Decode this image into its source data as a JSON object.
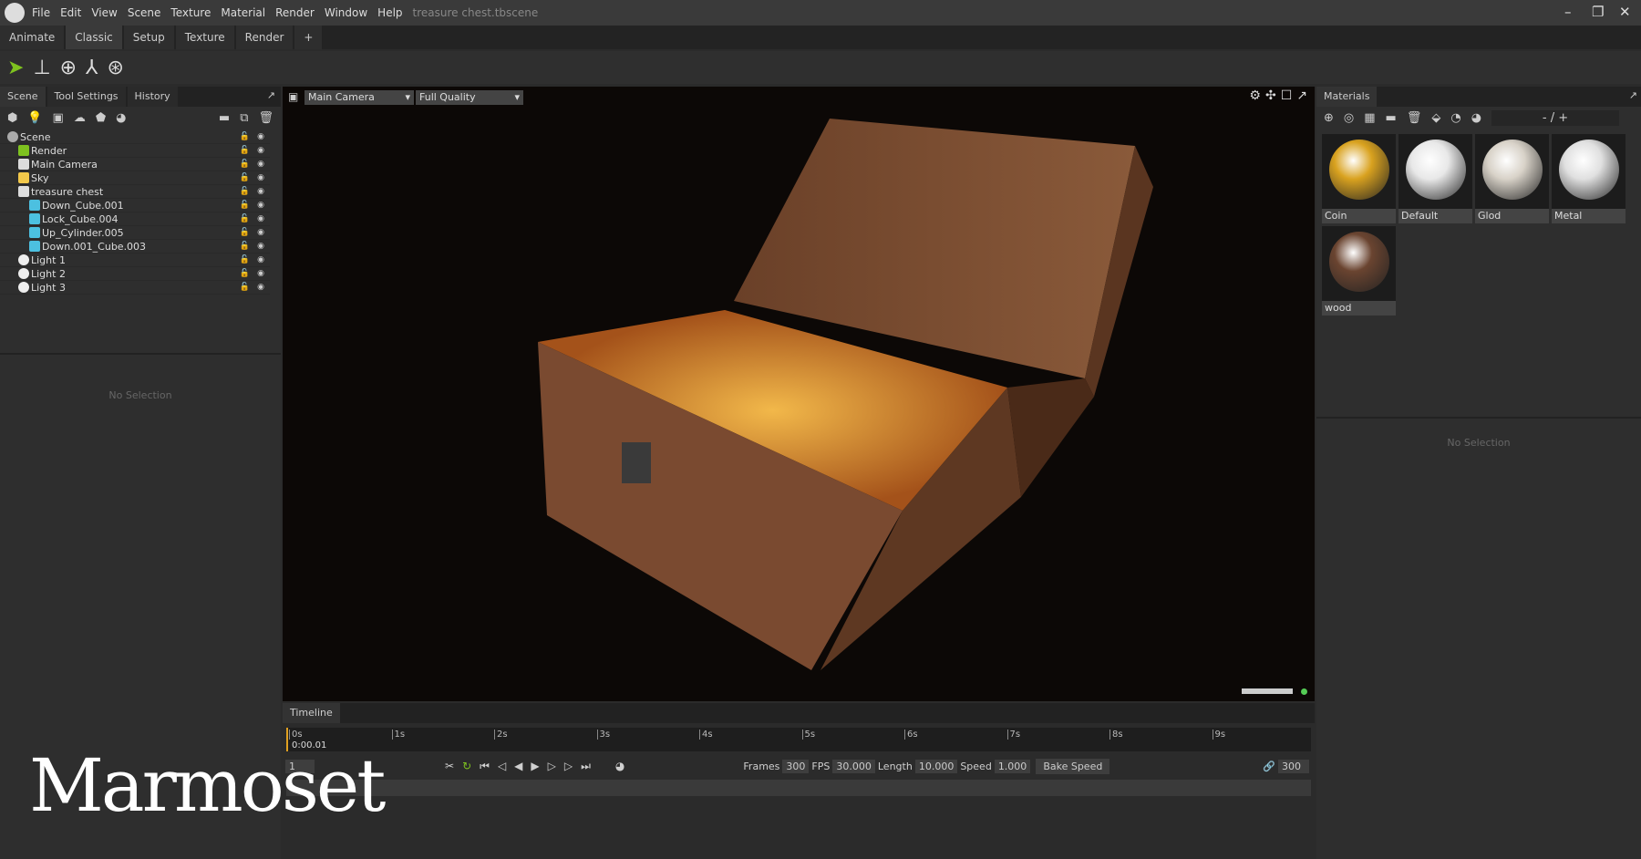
{
  "menu": {
    "items": [
      "File",
      "Edit",
      "View",
      "Scene",
      "Texture",
      "Material",
      "Render",
      "Window",
      "Help"
    ],
    "file_title": "treasure chest.tbscene"
  },
  "workspace_tabs": [
    "Animate",
    "Classic",
    "Setup",
    "Texture",
    "Render",
    "+"
  ],
  "workspace_active": "Classic",
  "left": {
    "tabs": [
      "Scene",
      "Tool Settings",
      "History"
    ],
    "active": "Scene",
    "tree": [
      {
        "label": "Scene",
        "icon": "scene-icon",
        "indent": 0
      },
      {
        "label": "Render",
        "icon": "gear-icon",
        "indent": 1
      },
      {
        "label": "Main Camera",
        "icon": "camera-icon",
        "indent": 1
      },
      {
        "label": "Sky",
        "icon": "sky-icon",
        "indent": 1
      },
      {
        "label": "treasure chest",
        "icon": "group-icon",
        "indent": 1
      },
      {
        "label": "Down_Cube.001",
        "icon": "mesh-icon",
        "indent": 2
      },
      {
        "label": "Lock_Cube.004",
        "icon": "mesh-icon",
        "indent": 2
      },
      {
        "label": "Up_Cylinder.005",
        "icon": "mesh-icon",
        "indent": 2
      },
      {
        "label": "Down.001_Cube.003",
        "icon": "mesh-icon",
        "indent": 2
      },
      {
        "label": "Light 1",
        "icon": "light-icon",
        "indent": 1
      },
      {
        "label": "Light 2",
        "icon": "light-icon",
        "indent": 1
      },
      {
        "label": "Light 3",
        "icon": "light-icon",
        "indent": 1
      }
    ],
    "no_selection": "No Selection"
  },
  "viewport": {
    "camera": "Main Camera",
    "quality": "Full Quality"
  },
  "materials": {
    "tab": "Materials",
    "zoom_label": "- / +",
    "items": [
      {
        "name": "Coin",
        "color": "#d9a21f"
      },
      {
        "name": "Default",
        "color": "#e8e8e8"
      },
      {
        "name": "Glod",
        "color": "#d8d2c8"
      },
      {
        "name": "Metal",
        "color": "#e0e0e0"
      },
      {
        "name": "wood",
        "color": "#6a4430"
      }
    ],
    "no_selection": "No Selection"
  },
  "timeline": {
    "tab": "Timeline",
    "ticks": [
      "0s",
      "1s",
      "2s",
      "3s",
      "4s",
      "5s",
      "6s",
      "7s",
      "8s",
      "9s"
    ],
    "current_time": "0:00.01",
    "frame": "1",
    "frames_label": "Frames",
    "frames": "300",
    "fps_label": "FPS",
    "fps": "30.000",
    "length_label": "Length",
    "length": "10.000",
    "speed_label": "Speed",
    "speed": "1.000",
    "bake_speed": "Bake Speed",
    "end_frame": "300"
  },
  "watermark": "Marmoset"
}
